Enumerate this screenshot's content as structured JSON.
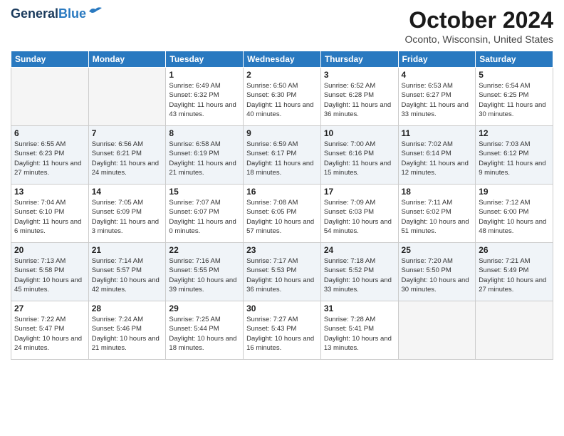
{
  "header": {
    "logo_line1": "General",
    "logo_line2": "Blue",
    "month": "October 2024",
    "location": "Oconto, Wisconsin, United States"
  },
  "weekdays": [
    "Sunday",
    "Monday",
    "Tuesday",
    "Wednesday",
    "Thursday",
    "Friday",
    "Saturday"
  ],
  "weeks": [
    [
      {
        "day": "",
        "empty": true
      },
      {
        "day": "",
        "empty": true
      },
      {
        "day": "1",
        "sunrise": "6:49 AM",
        "sunset": "6:32 PM",
        "daylight": "11 hours and 43 minutes."
      },
      {
        "day": "2",
        "sunrise": "6:50 AM",
        "sunset": "6:30 PM",
        "daylight": "11 hours and 40 minutes."
      },
      {
        "day": "3",
        "sunrise": "6:52 AM",
        "sunset": "6:28 PM",
        "daylight": "11 hours and 36 minutes."
      },
      {
        "day": "4",
        "sunrise": "6:53 AM",
        "sunset": "6:27 PM",
        "daylight": "11 hours and 33 minutes."
      },
      {
        "day": "5",
        "sunrise": "6:54 AM",
        "sunset": "6:25 PM",
        "daylight": "11 hours and 30 minutes."
      }
    ],
    [
      {
        "day": "6",
        "sunrise": "6:55 AM",
        "sunset": "6:23 PM",
        "daylight": "11 hours and 27 minutes."
      },
      {
        "day": "7",
        "sunrise": "6:56 AM",
        "sunset": "6:21 PM",
        "daylight": "11 hours and 24 minutes."
      },
      {
        "day": "8",
        "sunrise": "6:58 AM",
        "sunset": "6:19 PM",
        "daylight": "11 hours and 21 minutes."
      },
      {
        "day": "9",
        "sunrise": "6:59 AM",
        "sunset": "6:17 PM",
        "daylight": "11 hours and 18 minutes."
      },
      {
        "day": "10",
        "sunrise": "7:00 AM",
        "sunset": "6:16 PM",
        "daylight": "11 hours and 15 minutes."
      },
      {
        "day": "11",
        "sunrise": "7:02 AM",
        "sunset": "6:14 PM",
        "daylight": "11 hours and 12 minutes."
      },
      {
        "day": "12",
        "sunrise": "7:03 AM",
        "sunset": "6:12 PM",
        "daylight": "11 hours and 9 minutes."
      }
    ],
    [
      {
        "day": "13",
        "sunrise": "7:04 AM",
        "sunset": "6:10 PM",
        "daylight": "11 hours and 6 minutes."
      },
      {
        "day": "14",
        "sunrise": "7:05 AM",
        "sunset": "6:09 PM",
        "daylight": "11 hours and 3 minutes."
      },
      {
        "day": "15",
        "sunrise": "7:07 AM",
        "sunset": "6:07 PM",
        "daylight": "11 hours and 0 minutes."
      },
      {
        "day": "16",
        "sunrise": "7:08 AM",
        "sunset": "6:05 PM",
        "daylight": "10 hours and 57 minutes."
      },
      {
        "day": "17",
        "sunrise": "7:09 AM",
        "sunset": "6:03 PM",
        "daylight": "10 hours and 54 minutes."
      },
      {
        "day": "18",
        "sunrise": "7:11 AM",
        "sunset": "6:02 PM",
        "daylight": "10 hours and 51 minutes."
      },
      {
        "day": "19",
        "sunrise": "7:12 AM",
        "sunset": "6:00 PM",
        "daylight": "10 hours and 48 minutes."
      }
    ],
    [
      {
        "day": "20",
        "sunrise": "7:13 AM",
        "sunset": "5:58 PM",
        "daylight": "10 hours and 45 minutes."
      },
      {
        "day": "21",
        "sunrise": "7:14 AM",
        "sunset": "5:57 PM",
        "daylight": "10 hours and 42 minutes."
      },
      {
        "day": "22",
        "sunrise": "7:16 AM",
        "sunset": "5:55 PM",
        "daylight": "10 hours and 39 minutes."
      },
      {
        "day": "23",
        "sunrise": "7:17 AM",
        "sunset": "5:53 PM",
        "daylight": "10 hours and 36 minutes."
      },
      {
        "day": "24",
        "sunrise": "7:18 AM",
        "sunset": "5:52 PM",
        "daylight": "10 hours and 33 minutes."
      },
      {
        "day": "25",
        "sunrise": "7:20 AM",
        "sunset": "5:50 PM",
        "daylight": "10 hours and 30 minutes."
      },
      {
        "day": "26",
        "sunrise": "7:21 AM",
        "sunset": "5:49 PM",
        "daylight": "10 hours and 27 minutes."
      }
    ],
    [
      {
        "day": "27",
        "sunrise": "7:22 AM",
        "sunset": "5:47 PM",
        "daylight": "10 hours and 24 minutes."
      },
      {
        "day": "28",
        "sunrise": "7:24 AM",
        "sunset": "5:46 PM",
        "daylight": "10 hours and 21 minutes."
      },
      {
        "day": "29",
        "sunrise": "7:25 AM",
        "sunset": "5:44 PM",
        "daylight": "10 hours and 18 minutes."
      },
      {
        "day": "30",
        "sunrise": "7:27 AM",
        "sunset": "5:43 PM",
        "daylight": "10 hours and 16 minutes."
      },
      {
        "day": "31",
        "sunrise": "7:28 AM",
        "sunset": "5:41 PM",
        "daylight": "10 hours and 13 minutes."
      },
      {
        "day": "",
        "empty": true
      },
      {
        "day": "",
        "empty": true
      }
    ]
  ]
}
